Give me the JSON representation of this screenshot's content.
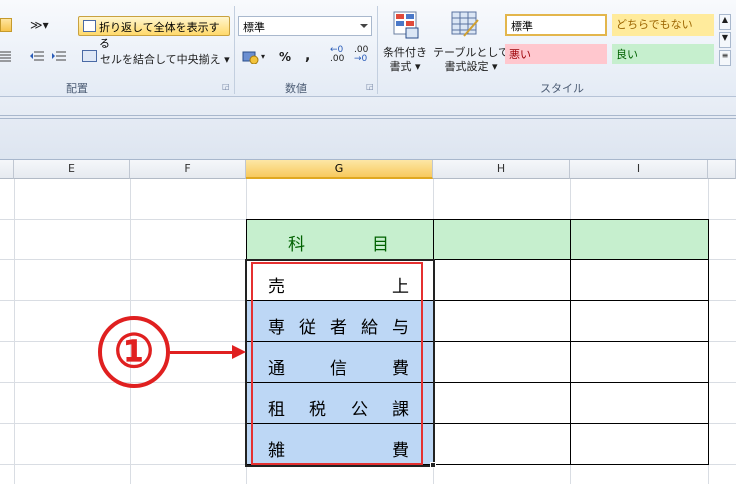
{
  "ribbon": {
    "wrap_text_label": "折り返して全体を表示する",
    "merge_center_label": "セルを結合して中央揃え",
    "alignment_group": "配置",
    "number_format_value": "標準",
    "percent_label": "%",
    "comma_label": ",",
    "dec_increase_label": ".00",
    "dec_decrease_label": ".00",
    "number_group": "数値",
    "cond_format_line1": "条件付き",
    "cond_format_line2": "書式",
    "table_format_line1": "テーブルとして",
    "table_format_line2": "書式設定",
    "styles_group": "スタイル",
    "style_normal": "標準",
    "style_neutral": "どちらでもない",
    "style_bad": "悪い",
    "style_good": "良い"
  },
  "columns": [
    "E",
    "F",
    "G",
    "H",
    "I"
  ],
  "selected_column": "G",
  "header_cell": {
    "char1": "科",
    "char2": "目"
  },
  "rows": [
    {
      "label": "売　　　　上",
      "chars": [
        "売",
        "上"
      ]
    },
    {
      "label": "専従者給与",
      "chars": [
        "専",
        "従",
        "者",
        "給",
        "与"
      ]
    },
    {
      "label": "通　信　費",
      "chars": [
        "通",
        "信",
        "費"
      ]
    },
    {
      "label": "租税公課",
      "chars": [
        "租",
        "税",
        "公",
        "課"
      ]
    },
    {
      "label": "雑　　　　費",
      "chars": [
        "雑",
        "費"
      ]
    }
  ],
  "annotation": {
    "number": "①"
  },
  "colors": {
    "header_green": "#c6efce",
    "selection_blue": "#bdd7f5",
    "annotation_red": "#e02020"
  }
}
